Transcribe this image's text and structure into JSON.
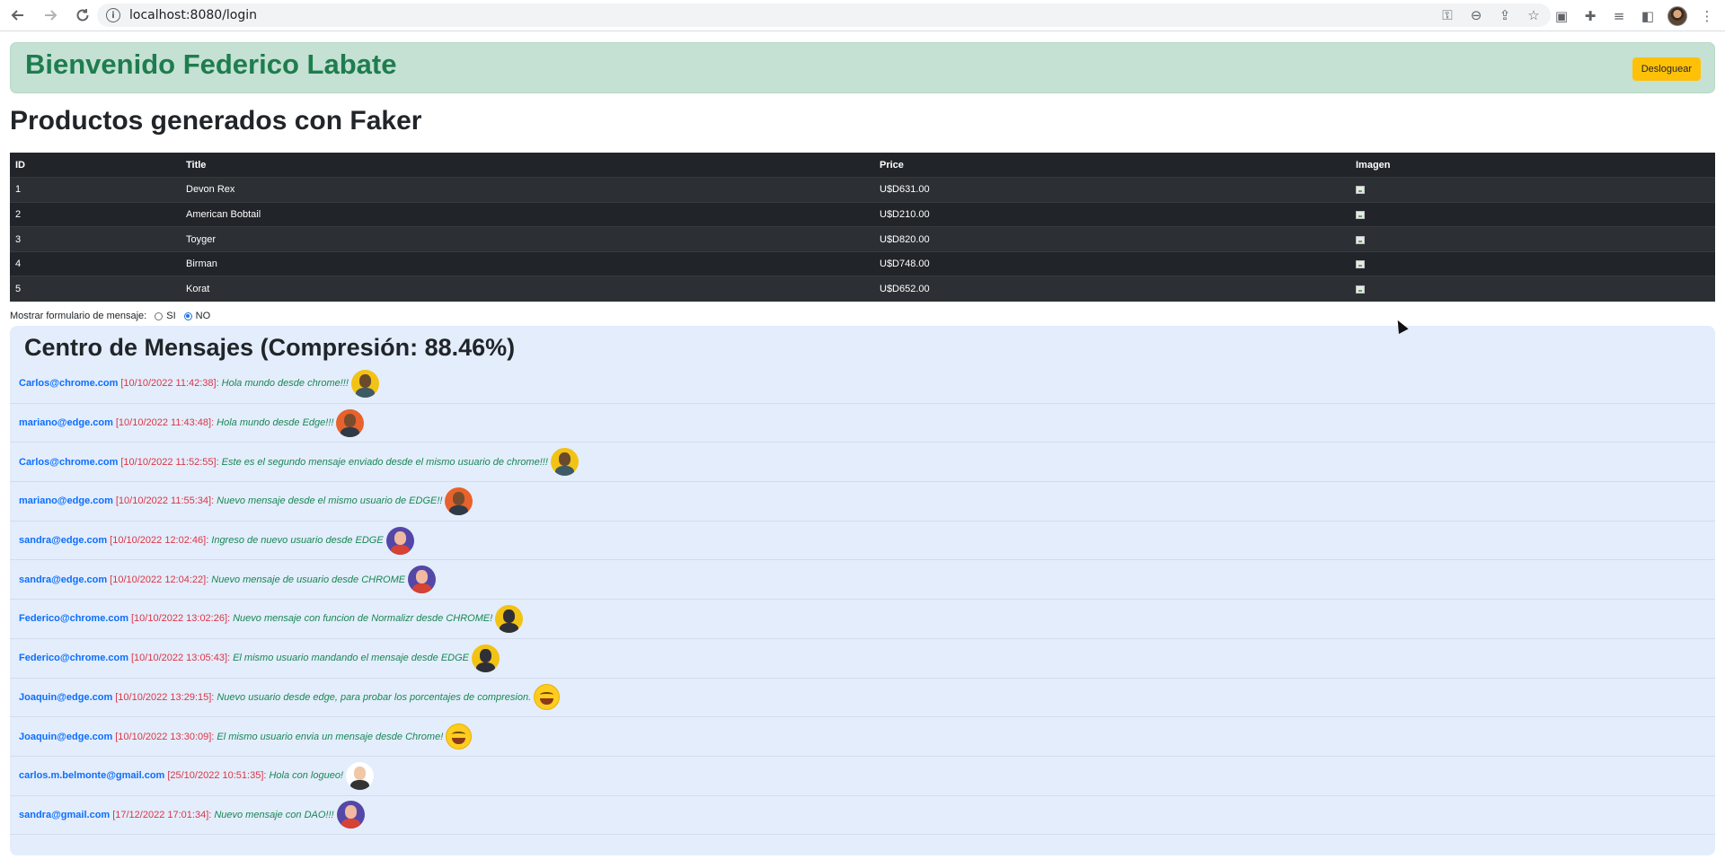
{
  "browser": {
    "url": "localhost:8080/login",
    "omnibox_icons": [
      "key-icon",
      "zoom-icon",
      "share-icon",
      "star-icon"
    ],
    "toolbar_icons": [
      "cast-icon",
      "extensions-icon",
      "reading-list-icon",
      "side-panel-icon",
      "profile-avatar",
      "menu-icon"
    ]
  },
  "header": {
    "welcome": "Bienvenido Federico Labate",
    "logout_label": "Desloguear"
  },
  "products": {
    "title": "Productos generados con Faker",
    "columns": [
      "ID",
      "Title",
      "Price",
      "Imagen"
    ],
    "rows": [
      {
        "id": "1",
        "title": "Devon Rex",
        "price": "U$D631.00"
      },
      {
        "id": "2",
        "title": "American Bobtail",
        "price": "U$D210.00"
      },
      {
        "id": "3",
        "title": "Toyger",
        "price": "U$D820.00"
      },
      {
        "id": "4",
        "title": "Birman",
        "price": "U$D748.00"
      },
      {
        "id": "5",
        "title": "Korat",
        "price": "U$D652.00"
      }
    ]
  },
  "form_toggle": {
    "label": "Mostrar formulario de mensaje:",
    "options": [
      {
        "label": "SI",
        "checked": false
      },
      {
        "label": "NO",
        "checked": true
      }
    ]
  },
  "messages": {
    "title": "Centro de Mensajes (Compresión: 88.46%)",
    "items": [
      {
        "email": "Carlos@chrome.com",
        "date": "[10/10/2022 11:42:38]",
        "text": "Hola mundo desde chrome!!!",
        "avatar": "yellow"
      },
      {
        "email": "mariano@edge.com",
        "date": "[10/10/2022 11:43:48]",
        "text": "Hola mundo desde Edge!!!",
        "avatar": "orange"
      },
      {
        "email": "Carlos@chrome.com",
        "date": "[10/10/2022 11:52:55]",
        "text": "Este es el segundo mensaje enviado desde el mismo usuario de chrome!!!",
        "avatar": "yellow"
      },
      {
        "email": "mariano@edge.com",
        "date": "[10/10/2022 11:55:34]",
        "text": "Nuevo mensaje desde el mismo usuario de EDGE!!",
        "avatar": "orange"
      },
      {
        "email": "sandra@edge.com",
        "date": "[10/10/2022 12:02:46]",
        "text": "Ingreso de nuevo usuario desde EDGE",
        "avatar": "purple"
      },
      {
        "email": "sandra@edge.com",
        "date": "[10/10/2022 12:04:22]",
        "text": "Nuevo mensaje de usuario desde CHROME",
        "avatar": "purple"
      },
      {
        "email": "Federico@chrome.com",
        "date": "[10/10/2022 13:02:26]",
        "text": "Nuevo mensaje con funcion de Normalizr desde CHROME!",
        "avatar": "batman"
      },
      {
        "email": "Federico@chrome.com",
        "date": "[10/10/2022 13:05:43]",
        "text": "El mismo usuario mandando el mensaje desde EDGE",
        "avatar": "batman"
      },
      {
        "email": "Joaquin@edge.com",
        "date": "[10/10/2022 13:29:15]",
        "text": "Nuevo usuario desde edge, para probar los porcentajes de compresion.",
        "avatar": "emoji"
      },
      {
        "email": "Joaquin@edge.com",
        "date": "[10/10/2022 13:30:09]",
        "text": "El mismo usuario envia un mensaje desde Chrome!",
        "avatar": "emoji"
      },
      {
        "email": "carlos.m.belmonte@gmail.com",
        "date": "[25/10/2022 10:51:35]",
        "text": "Hola con logueo!",
        "avatar": "white"
      },
      {
        "email": "sandra@gmail.com",
        "date": "[17/12/2022 17:01:34]",
        "text": "Nuevo mensaje con DAO!!!",
        "avatar": "purple"
      }
    ]
  }
}
